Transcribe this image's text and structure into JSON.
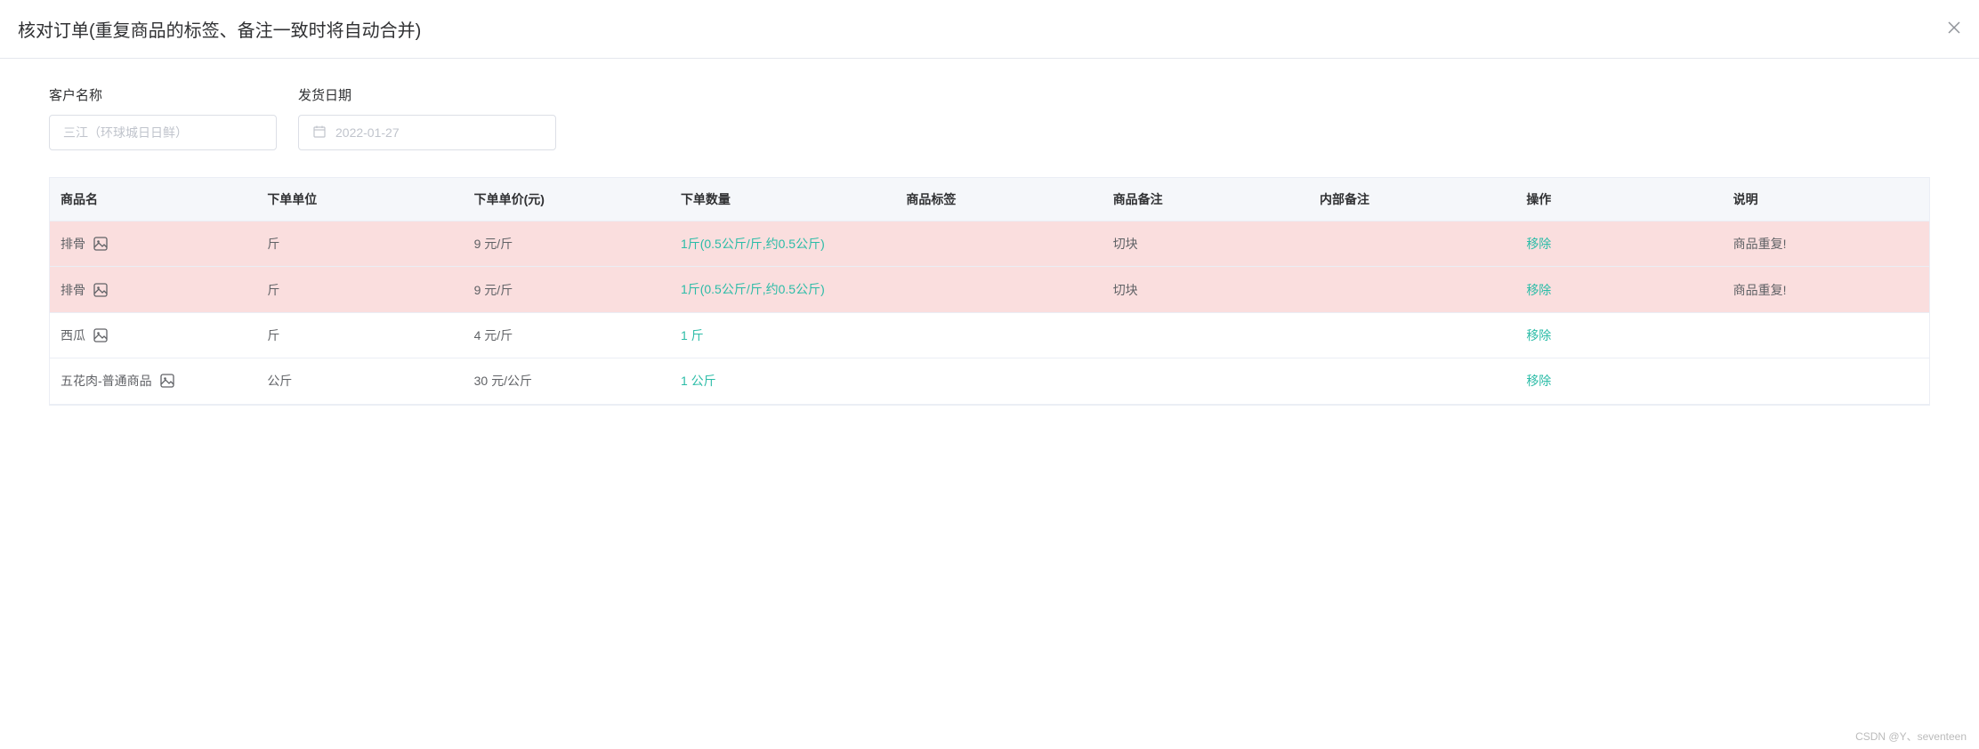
{
  "header": {
    "title": "核对订单(重复商品的标签、备注一致时将自动合并)"
  },
  "form": {
    "customer": {
      "label": "客户名称",
      "value": "三江（环球城日日鲜）"
    },
    "date": {
      "label": "发货日期",
      "value": "2022-01-27"
    }
  },
  "table": {
    "columns": {
      "name": "商品名",
      "unit": "下单单位",
      "price": "下单单价(元)",
      "qty": "下单数量",
      "tag": "商品标签",
      "remark": "商品备注",
      "internal": "内部备注",
      "action": "操作",
      "desc": "说明"
    },
    "rows": [
      {
        "name": "排骨",
        "unit": "斤",
        "price": "9 元/斤",
        "qty": "1斤(0.5公斤/斤,约0.5公斤)",
        "tag": "",
        "remark": "切块",
        "internal": "",
        "action": "移除",
        "desc": "商品重复!",
        "duplicate": true
      },
      {
        "name": "排骨",
        "unit": "斤",
        "price": "9 元/斤",
        "qty": "1斤(0.5公斤/斤,约0.5公斤)",
        "tag": "",
        "remark": "切块",
        "internal": "",
        "action": "移除",
        "desc": "商品重复!",
        "duplicate": true
      },
      {
        "name": "西瓜",
        "unit": "斤",
        "price": "4 元/斤",
        "qty": "1 斤",
        "tag": "",
        "remark": "",
        "internal": "",
        "action": "移除",
        "desc": "",
        "duplicate": false
      },
      {
        "name": "五花肉-普通商品",
        "unit": "公斤",
        "price": "30 元/公斤",
        "qty": "1 公斤",
        "tag": "",
        "remark": "",
        "internal": "",
        "action": "移除",
        "desc": "",
        "duplicate": false
      }
    ]
  },
  "watermark": "CSDN @Y、seventeen"
}
